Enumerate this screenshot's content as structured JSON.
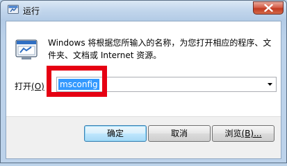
{
  "window": {
    "title": "运行",
    "icon": "run-app-icon",
    "close_icon": "close-icon"
  },
  "description": "Windows 将根据您所输入的名称，为您打开相应的程序、文件夹、文档或 Internet 资源。",
  "open_field": {
    "label_text": "打开",
    "label_accel": "(O)",
    "value": "msconfig"
  },
  "buttons": {
    "ok_label": "确定",
    "cancel_label": "取消",
    "browse_text": "浏览",
    "browse_accel": "(B)..."
  },
  "colors": {
    "highlight_box": "#e60012",
    "selection": "#3399ff"
  }
}
